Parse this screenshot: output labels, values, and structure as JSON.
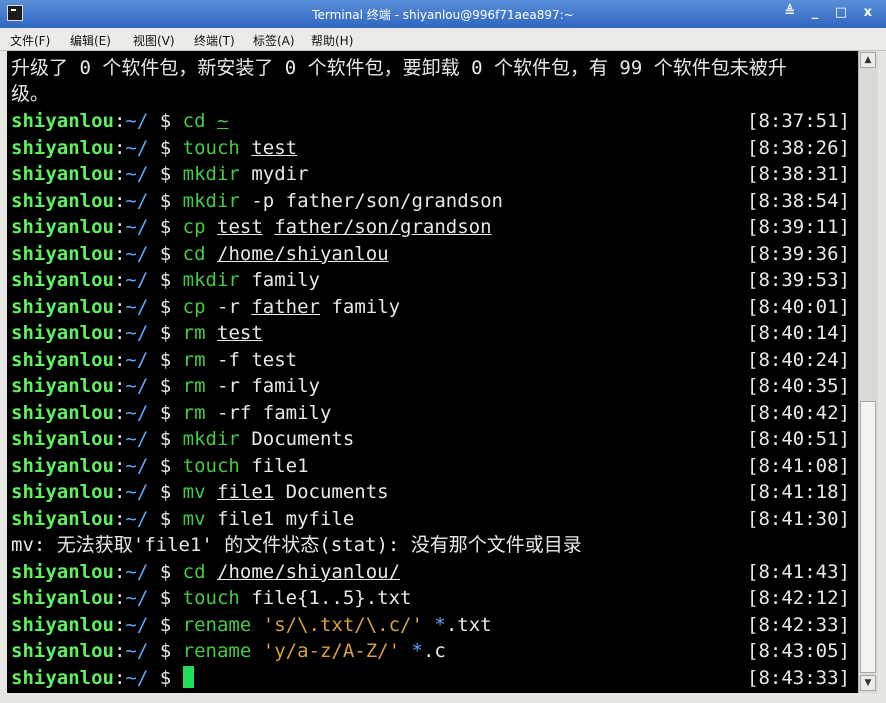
{
  "window": {
    "title": "Terminal 终端 - shiyanlou@996f71aea897:~",
    "controls": "≜ _ □ x"
  },
  "menu": [
    "文件(F)",
    "编辑(E)",
    "视图(V)",
    "终端(T)",
    "标签(A)",
    "帮助(H)"
  ],
  "terminal": {
    "intro_line1": "升级了 0 个软件包，新安装了 0 个软件包，要卸载 0 个软件包，有 99 个软件包未被升",
    "intro_line2": "级。",
    "prompt_user": "shiyanlou",
    "prompt_sep": ":",
    "prompt_path": "~/",
    "prompt_dollar": "$",
    "error_line": "mv: 无法获取'file1' 的文件状态(stat): 没有那个文件或目录",
    "commands": [
      {
        "cmd": "cd",
        "a1": "~",
        "time": "[8:37:51]"
      },
      {
        "cmd": "touch",
        "a1": "test",
        "time": "[8:38:26]"
      },
      {
        "cmd": "mkdir",
        "a1": "mydir",
        "time": "[8:38:31]"
      },
      {
        "cmd": "mkdir",
        "a1": "-p father/son/grandson",
        "time": "[8:38:54]"
      },
      {
        "cmd": "cp",
        "a1": "test",
        "a2": "father/son/grandson",
        "time": "[8:39:11]"
      },
      {
        "cmd": "cd",
        "a1": "/home/shiyanlou",
        "time": "[8:39:36]"
      },
      {
        "cmd": "mkdir",
        "a1": "family",
        "time": "[8:39:53]"
      },
      {
        "cmd": "cp",
        "a1": "-r",
        "a2": "father",
        "a3": "family",
        "time": "[8:40:01]"
      },
      {
        "cmd": "rm",
        "a1": "test",
        "time": "[8:40:14]"
      },
      {
        "cmd": "rm",
        "a1": "-f test",
        "time": "[8:40:24]"
      },
      {
        "cmd": "rm",
        "a1": "-r",
        "a2": "family",
        "time": "[8:40:35]"
      },
      {
        "cmd": "rm",
        "a1": "-rf family",
        "time": "[8:40:42]"
      },
      {
        "cmd": "mkdir",
        "a1": "Documents",
        "time": "[8:40:51]"
      },
      {
        "cmd": "touch",
        "a1": "file1",
        "time": "[8:41:08]"
      },
      {
        "cmd": "mv",
        "a1": "file1",
        "a2": "Documents",
        "time": "[8:41:18]"
      },
      {
        "cmd": "mv",
        "a1": "file1 myfile",
        "time": "[8:41:30]"
      },
      {
        "cmd": "cd",
        "a1": "/home/shiyanlou/",
        "time": "[8:41:43]"
      },
      {
        "cmd": "touch",
        "a1": "file{1..5}.txt",
        "time": "[8:42:12]"
      },
      {
        "cmd": "rename",
        "a1": "'s/\\.txt/\\.c/'",
        "a2": "*",
        "a3": ".txt",
        "time": "[8:42:33]"
      },
      {
        "cmd": "rename",
        "a1": "'y/a-z/A-Z/'",
        "a2": "*",
        "a3": ".c",
        "time": "[8:43:05]"
      }
    ],
    "last_time": "[8:43:33]"
  },
  "scrollbar": {
    "up": "▲",
    "down": "▼"
  }
}
